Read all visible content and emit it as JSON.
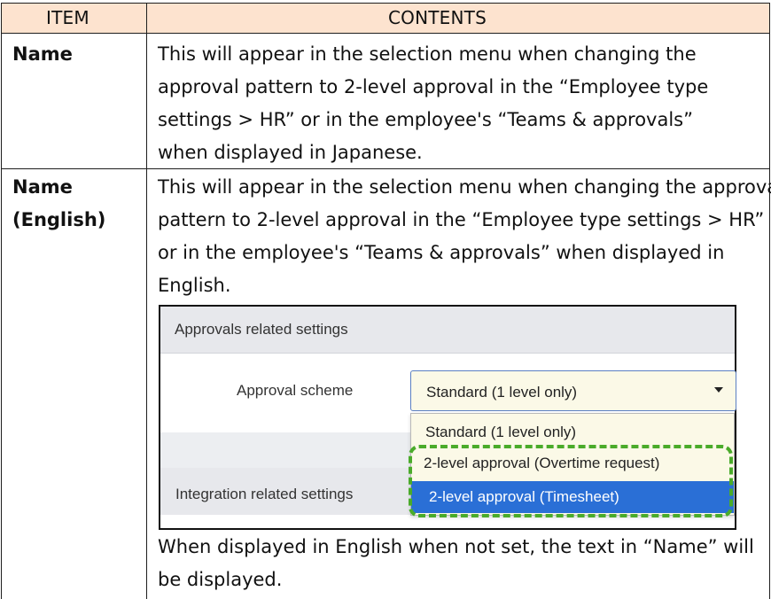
{
  "table": {
    "headers": {
      "item": "ITEM",
      "contents": "CONTENTS"
    },
    "rows": [
      {
        "item": "Name",
        "lines": [
          "This will appear in the selection menu when changing the",
          "approval pattern to 2-level approval in the “Employee type",
          "settings > HR” or in the employee's “Teams & approvals”",
          "when displayed in Japanese."
        ]
      },
      {
        "item_lines": [
          "Name",
          "(English)"
        ],
        "lines": [
          "This will appear in the selection menu when changing the approval",
          "pattern to 2-level approval in the “Employee type settings > HR”",
          "or in the employee's “Teams & approvals” when displayed in",
          "English."
        ],
        "after_lines": [
          "When displayed in English when not set, the text in “Name” will",
          "be displayed."
        ]
      }
    ]
  },
  "screenshot": {
    "section1_title": "Approvals related settings",
    "field_label": "Approval scheme",
    "select_value": "Standard (1 level only)",
    "options": [
      "Standard (1 level only)",
      "2-level approval (Overtime request)",
      "2-level approval (Timesheet)"
    ],
    "selected_option_index": 2,
    "section2_title": "Integration related settings",
    "colors": {
      "header_bg": "#fde3cf",
      "select_bg": "#fbf9e7",
      "selected_bg": "#2a6fd6",
      "highlight": "#4aab2a"
    }
  }
}
